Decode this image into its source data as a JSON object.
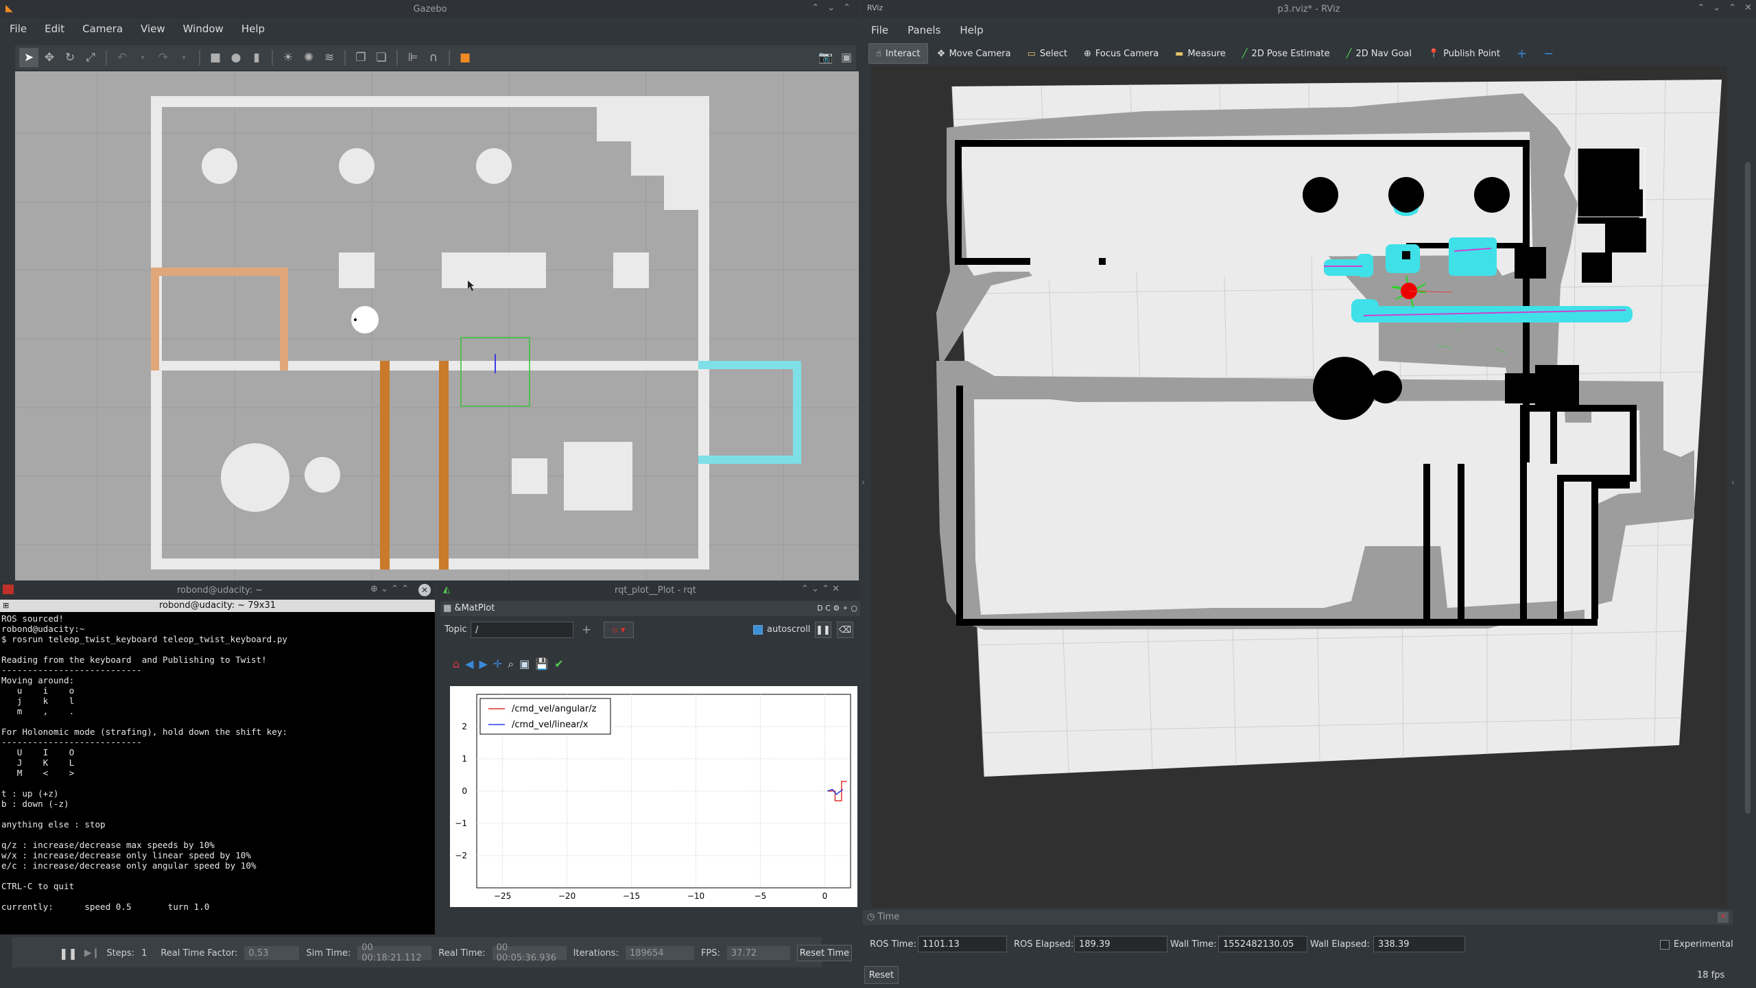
{
  "gazebo": {
    "title": "Gazebo",
    "menu": [
      "File",
      "Edit",
      "Camera",
      "View",
      "Window",
      "Help"
    ],
    "toolbar_icons": [
      "select-arrow-icon",
      "translate-icon",
      "rotate-icon",
      "scale-icon",
      "undo-icon",
      "redo-icon",
      "box-icon",
      "sphere-icon",
      "cylinder-icon",
      "point-light-icon",
      "spot-light-icon",
      "directional-light-icon",
      "copy-icon",
      "paste-icon",
      "align-icon",
      "snap-icon",
      "orange-marker-icon",
      "screenshot-icon",
      "record-icon"
    ],
    "status": {
      "steps_label": "Steps:",
      "steps_value": "1",
      "rtf_label": "Real Time Factor:",
      "rtf_value": "0.53",
      "sim_time_label": "Sim Time:",
      "sim_time_value": "00 00:18:21.112",
      "real_time_label": "Real Time:",
      "real_time_value": "00 00:05:36.936",
      "iterations_label": "Iterations:",
      "iterations_value": "189654",
      "fps_label": "FPS:",
      "fps_value": "37.72",
      "reset_time": "Reset Time"
    }
  },
  "terminal": {
    "title": "robond@udacity: ~",
    "header": "robond@udacity: ~ 79x31",
    "content": "ROS sourced!\nrobond@udacity:~\n$ rosrun teleop_twist_keyboard teleop_twist_keyboard.py\n\nReading from the keyboard  and Publishing to Twist!\n---------------------------\nMoving around:\n   u    i    o\n   j    k    l\n   m    ,    .\n\nFor Holonomic mode (strafing), hold down the shift key:\n---------------------------\n   U    I    O\n   J    K    L\n   M    <    >\n\nt : up (+z)\nb : down (-z)\n\nanything else : stop\n\nq/z : increase/decrease max speeds by 10%\nw/x : increase/decrease only linear speed by 10%\ne/c : increase/decrease only angular speed by 10%\n\nCTRL-C to quit\n\ncurrently:      speed 0.5       turn 1.0"
  },
  "rqt": {
    "title": "rqt_plot__Plot - rqt",
    "plugin": "&MatPlot",
    "plugin_controls": "D C",
    "topic_label": "Topic",
    "topic_value": "/",
    "autoscroll_label": "autoscroll",
    "legend": [
      "/cmd_vel/angular/z",
      "/cmd_vel/linear/x"
    ],
    "legend_colors": [
      "#e0302a",
      "#2a3ce0"
    ]
  },
  "chart_data": {
    "type": "line",
    "title": "",
    "xlabel": "",
    "ylabel": "",
    "xlim": [
      -27,
      2
    ],
    "ylim": [
      -3,
      3
    ],
    "xticks": [
      "−25",
      "−20",
      "−15",
      "−10",
      "−5",
      "0"
    ],
    "yticks": [
      "2",
      "1",
      "0",
      "−1",
      "−2"
    ],
    "series": [
      {
        "name": "/cmd_vel/angular/z",
        "color": "#e0302a",
        "x": [
          0.3,
          0.8,
          0.8,
          1.3,
          1.3,
          1.7
        ],
        "y": [
          0,
          0,
          -0.3,
          -0.3,
          0.3,
          0.3
        ]
      },
      {
        "name": "/cmd_vel/linear/x",
        "color": "#2a3ce0",
        "x": [
          0.2,
          0.6,
          0.9,
          1.4
        ],
        "y": [
          0,
          0.05,
          -0.1,
          0.05
        ]
      }
    ],
    "grid": true,
    "legend_position": "top-left"
  },
  "rviz": {
    "title": "p3.rviz* - RViz",
    "menu": [
      "File",
      "Panels",
      "Help"
    ],
    "tools": [
      "Interact",
      "Move Camera",
      "Select",
      "Focus Camera",
      "Measure",
      "2D Pose Estimate",
      "2D Nav Goal",
      "Publish Point"
    ],
    "time_panel_title": "Time",
    "ros_time_label": "ROS Time:",
    "ros_time": "1101.13",
    "ros_elapsed_label": "ROS Elapsed:",
    "ros_elapsed": "189.39",
    "wall_time_label": "Wall Time:",
    "wall_time": "1552482130.05",
    "wall_elapsed_label": "Wall Elapsed:",
    "wall_elapsed": "338.39",
    "experimental_label": "Experimental",
    "reset_label": "Reset",
    "fps": "18 fps"
  }
}
